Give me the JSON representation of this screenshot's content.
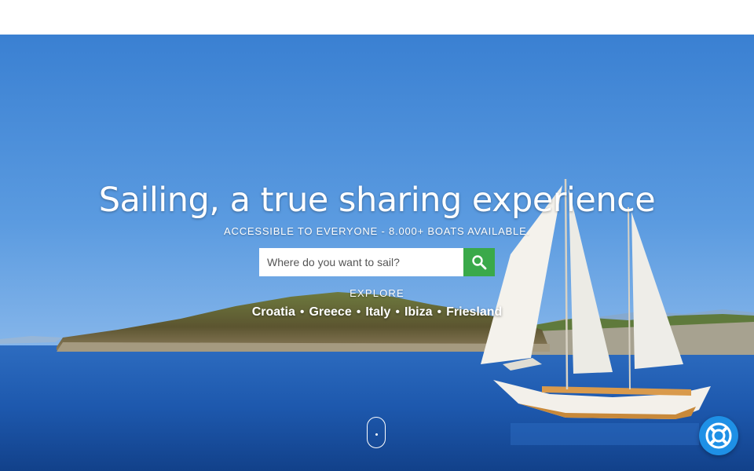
{
  "hero": {
    "headline": "Sailing, a true sharing experience",
    "subline": "ACCESSIBLE TO EVERYONE - 8.000+ BOATS AVAILABLE.",
    "search": {
      "placeholder": "Where do you want to sail?",
      "value": ""
    },
    "explore_label": "EXPLORE",
    "destinations": [
      "Croatia",
      "Greece",
      "Italy",
      "Ibiza",
      "Friesland"
    ],
    "separator": "•"
  },
  "colors": {
    "search_button": "#3aa94a",
    "help_button": "#1e90e6",
    "sky": "#3f86d6",
    "sea": "#1b55a8"
  },
  "icons": {
    "search": "search-icon",
    "help": "lifebuoy-icon",
    "scroll": "mouse-scroll-icon"
  }
}
